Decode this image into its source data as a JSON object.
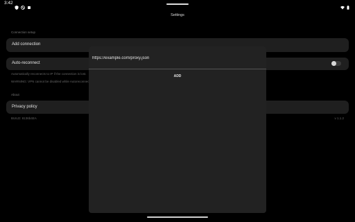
{
  "status_bar": {
    "time": "3:42",
    "left_icons": [
      "shield-icon",
      "no-sim-icon",
      "vpn-key-icon"
    ],
    "right_icons": [
      "wifi-icon",
      "battery-icon"
    ]
  },
  "header": {
    "title": "Settings"
  },
  "connection_setup": {
    "section_label": "Connection setup",
    "add_connection_label": "Add connection",
    "auto_reconnect_label": "Auto-reconnect",
    "auto_reconnect_enabled": false,
    "auto_reconnect_desc": "Automatically reconnects to IP if the connection is lost.",
    "auto_reconnect_warning": "WARNING: VPN cannot be disabled while Autoreconnect is on."
  },
  "about": {
    "section_label": "About",
    "privacy_policy_label": "Privacy policy",
    "build_label": "BUILD: 8136b4EA",
    "version_label": "v 1.1.2"
  },
  "dialog": {
    "input_value": "https://example.com/proxy.json",
    "add_button_label": "ADD"
  }
}
